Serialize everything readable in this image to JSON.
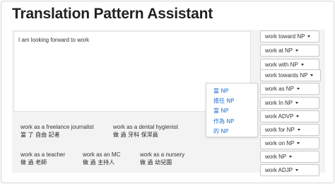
{
  "app": {
    "title": "Translation Pattern Assistant"
  },
  "input": {
    "text": "I am looking forward to work"
  },
  "patterns": [
    "work toward NP",
    "work at NP",
    "work with NP",
    "work towards NP",
    "work as NP",
    "work In NP",
    "work ADVP",
    "work for NP",
    "work on NP",
    "work NP",
    "work ADJP"
  ],
  "suggestions": [
    "當 NP",
    "擔任 NP",
    "當 NP",
    "作為 NP",
    "的 NP"
  ],
  "examples": [
    {
      "en": "work as a freelance journalist",
      "zh": "當 了 自由 記者"
    },
    {
      "en": "work as a dental hygienist",
      "zh": "做 過 牙科 保潔員"
    },
    {
      "en": "work as a teacher",
      "zh": "做 過 老師"
    },
    {
      "en": "work as an MC",
      "zh": "做 過 主持人"
    },
    {
      "en": "work as a nursery",
      "zh": "做 過 幼兒園"
    }
  ],
  "colors": {
    "link": "#1f6fd0",
    "panel": "#f3f3f3",
    "border": "#c9c9c9"
  }
}
